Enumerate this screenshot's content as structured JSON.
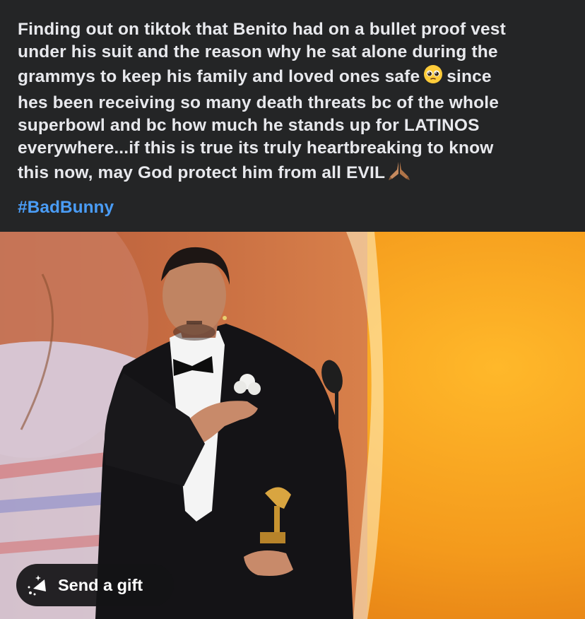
{
  "post": {
    "lines": [
      "Finding out on tiktok that Benito had on a bullet proof vest",
      "under his suit and the reason why he sat alone during the",
      "grammys to keep his family and loved ones safe",
      "since",
      "hes been receiving so many death threats bc of the whole",
      "superbowl and bc how much he stands up for LATINOS",
      "everywhere...if this is true its truly heartbreaking to know",
      "this now, may God protect him from all EVIL"
    ],
    "hashtag": "#BadBunny",
    "emoji_pleading": "pleading-face-emoji",
    "emoji_pray": "folded-hands-emoji"
  },
  "photo": {
    "description_icon": "photo",
    "background_color": "#f3a020"
  },
  "gift_button": {
    "label": "Send a gift",
    "icon": "gift-sparkle-icon"
  }
}
